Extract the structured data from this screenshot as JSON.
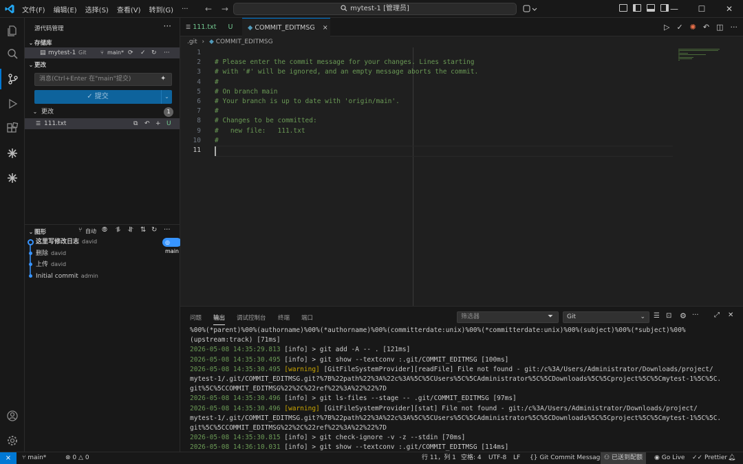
{
  "titlebar": {
    "menu": [
      "文件(F)",
      "编辑(E)",
      "选择(S)",
      "查看(V)",
      "转到(G)"
    ],
    "search_text": "mytest-1 [管理员]"
  },
  "sidebar": {
    "title": "源代码管理",
    "repos_header": "存储库",
    "repo": {
      "name": "mytest-1",
      "type": "Git",
      "branch": "main*"
    },
    "changes_header": "更改",
    "message_placeholder": "消息(Ctrl+Enter 在\"main\"提交)",
    "commit_label": "✓ 提交",
    "changes_group": "更改",
    "changes_count": "1",
    "file": {
      "name": "111.txt",
      "status": "U"
    },
    "graph_header": "图形",
    "graph_auto": "自动",
    "graph": [
      {
        "message": "这里写修改日志",
        "author": "david"
      },
      {
        "message": "删除",
        "author": "david"
      },
      {
        "message": "上传",
        "author": "david"
      },
      {
        "message": "Initial commit",
        "author": "admin"
      }
    ],
    "graph_branch": "main"
  },
  "editor": {
    "tabs": [
      {
        "label": "111.txt",
        "status": "U"
      },
      {
        "label": "COMMIT_EDITMSG",
        "close": "×"
      }
    ],
    "breadcrumb": [
      ".git",
      "COMMIT_EDITMSG"
    ],
    "lines": [
      "",
      "# Please enter the commit message for your changes. Lines starting",
      "# with '#' will be ignored, and an empty message aborts the commit.",
      "#",
      "# On branch main",
      "# Your branch is up to date with 'origin/main'.",
      "#",
      "# Changes to be committed:",
      "#   new file:   111.txt",
      "#",
      ""
    ],
    "line_numbers": [
      "1",
      "2",
      "3",
      "4",
      "5",
      "6",
      "7",
      "8",
      "9",
      "10",
      "11"
    ]
  },
  "panel": {
    "tabs": [
      "问题",
      "输出",
      "调试控制台",
      "终端",
      "端口"
    ],
    "active_tab": "输出",
    "filter_placeholder": "筛选器",
    "channel": "Git",
    "output": [
      {
        "ts": "",
        "level": "",
        "text": "%00%(*parent)%00%(authorname)%00%(*authorname)%00%(committerdate:unix)%00%(*committerdate:unix)%00%(subject)%00%(*subject)%00%"
      },
      {
        "ts": "",
        "level": "",
        "text": "(upstream:track) [71ms]"
      },
      {
        "ts": "2026-05-08 14:35:29.813",
        "level": "[info]",
        "text": " > git add -A -- . [121ms]"
      },
      {
        "ts": "2026-05-08 14:35:30.495",
        "level": "[info]",
        "text": " > git show --textconv :.git/COMMIT_EDITMSG [100ms]"
      },
      {
        "ts": "2026-05-08 14:35:30.495",
        "level": "[warning]",
        "text": " [GitFileSystemProvider][readFile] File not found - git:/c%3A/Users/Administrator/Downloads/project/"
      },
      {
        "ts": "",
        "level": "",
        "text": "mytest-1/.git/COMMIT_EDITMSG.git?%7B%22path%22%3A%22c%3A%5C%5CUsers%5C%5CAdministrator%5C%5CDownloads%5C%5Cproject%5C%5Cmytest-1%5C%5C."
      },
      {
        "ts": "",
        "level": "",
        "text": "git%5C%5CCOMMIT_EDITMSG%22%2C%22ref%22%3A%22%22%7D"
      },
      {
        "ts": "2026-05-08 14:35:30.496",
        "level": "[info]",
        "text": " > git ls-files --stage -- .git/COMMIT_EDITMSG [97ms]"
      },
      {
        "ts": "2026-05-08 14:35:30.496",
        "level": "[warning]",
        "text": " [GitFileSystemProvider][stat] File not found - git:/c%3A/Users/Administrator/Downloads/project/"
      },
      {
        "ts": "",
        "level": "",
        "text": "mytest-1/.git/COMMIT_EDITMSG.git?%7B%22path%22%3A%22c%3A%5C%5CUsers%5C%5CAdministrator%5C%5CDownloads%5C%5Cproject%5C%5Cmytest-1%5C%5C."
      },
      {
        "ts": "",
        "level": "",
        "text": "git%5C%5CCOMMIT_EDITMSG%22%2C%22ref%22%3A%22%22%7D"
      },
      {
        "ts": "2026-05-08 14:35:30.815",
        "level": "[info]",
        "text": " > git check-ignore -v -z --stdin [70ms]"
      },
      {
        "ts": "2026-05-08 14:36:10.031",
        "level": "[info]",
        "text": " > git show --textconv :.git/COMMIT_EDITMSG [114ms]"
      }
    ]
  },
  "statusbar": {
    "remote": "⨯",
    "branch": "main*",
    "problems": "0",
    "warnings": "0",
    "position": "行 11，列 1",
    "spaces": "空格: 4",
    "encoding": "UTF-8",
    "eol": "LF",
    "language": "Git Commit Message",
    "connected": "已送到配额",
    "golive": "Go Live",
    "prettier": "Prettier"
  },
  "colors": {
    "accent": "#0078d4",
    "comment": "#6a9955",
    "warning": "#cca700",
    "badge": "#3794ff"
  }
}
